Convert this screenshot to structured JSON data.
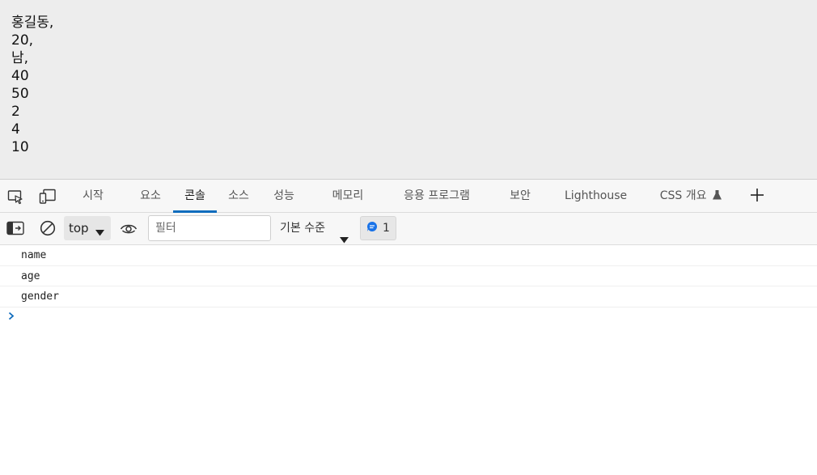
{
  "page": {
    "lines": [
      "홍길동,",
      "20,",
      "남,",
      "40",
      "50",
      "2",
      "4",
      "10"
    ]
  },
  "devtools": {
    "tabs": [
      {
        "label": "시작"
      },
      {
        "label": "요소"
      },
      {
        "label": "콘솔"
      },
      {
        "label": "소스"
      },
      {
        "label": "성능"
      },
      {
        "label": "메모리"
      },
      {
        "label": "응용 프로그램"
      },
      {
        "label": "보안"
      },
      {
        "label": "Lighthouse"
      },
      {
        "label": "CSS 개요"
      }
    ],
    "active_tab": "콘솔",
    "accent_color": "#0f6cbd"
  },
  "toolbar": {
    "context_value": "top",
    "filter_placeholder": "필터",
    "levels_label": "기본 수준",
    "issues_count": "1"
  },
  "console": {
    "logs": [
      "name",
      "age",
      "gender"
    ]
  },
  "icons": {
    "inspect": "inspect-element-icon",
    "device": "device-toolbar-icon",
    "sidebar": "console-sidebar-icon",
    "clear": "clear-console-icon",
    "eye": "live-expression-icon",
    "issues": "issues-message-icon",
    "flask": "experiment-flask-icon",
    "add": "more-tools-plus-icon",
    "prompt": "console-prompt-chevron-icon"
  }
}
